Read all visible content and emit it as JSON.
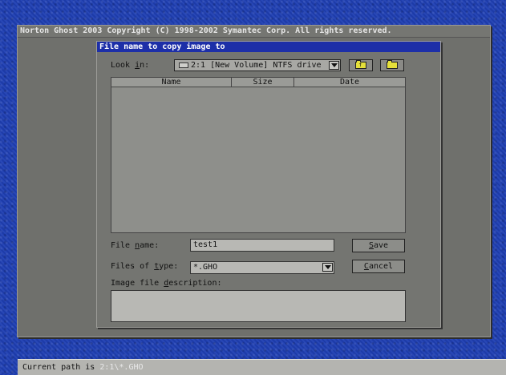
{
  "app": {
    "title": "Norton Ghost 2003   Copyright (C) 1998-2002 Symantec Corp. All rights reserved."
  },
  "dialog": {
    "title": "File name to copy image to",
    "look_in_label_pre": "Look ",
    "look_in_label_u": "i",
    "look_in_label_post": "n:",
    "look_in_value": "2:1 [New Volume] NTFS drive",
    "up_icon": "folder-up-icon",
    "new_folder_icon": "new-folder-icon",
    "columns": [
      "Name",
      "Size",
      "Date"
    ],
    "file_name_label_pre": "File ",
    "file_name_label_u": "n",
    "file_name_label_post": "ame:",
    "file_name_value": "test1",
    "files_of_type_label_pre": "Files of ",
    "files_of_type_label_u": "t",
    "files_of_type_label_post": "ype:",
    "files_of_type_value": "*.GHO",
    "description_label_pre": "Image file ",
    "description_label_u": "d",
    "description_label_post": "escription:",
    "description_value": "",
    "save_u": "S",
    "save_rest": "ave",
    "cancel_u": "C",
    "cancel_rest": "ancel"
  },
  "status": {
    "prefix": "Current path is ",
    "path": "2:1\\*.GHO"
  }
}
